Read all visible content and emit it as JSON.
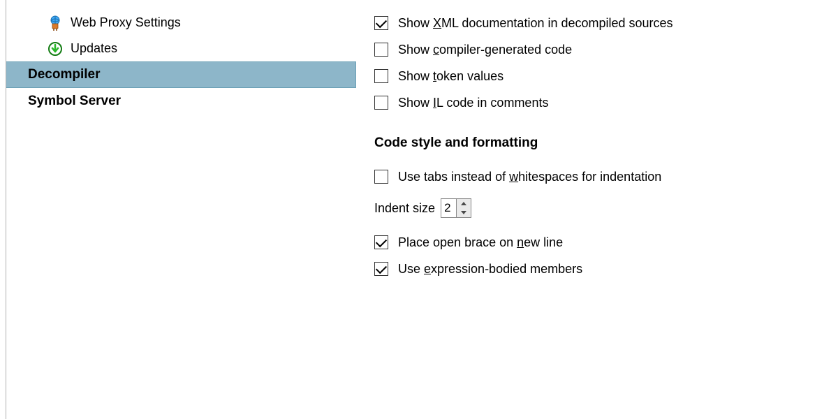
{
  "sidebar": {
    "items": [
      {
        "label": "Web Proxy Settings",
        "icon": "globe-plug-icon"
      },
      {
        "label": "Updates",
        "icon": "download-icon"
      }
    ],
    "roots": [
      {
        "label": "Decompiler",
        "selected": true
      },
      {
        "label": "Symbol Server",
        "selected": false
      }
    ]
  },
  "content": {
    "options_top": [
      {
        "id": "xml-doc",
        "checked": true,
        "text_before": "Show ",
        "mnemonic": "X",
        "text_after": "ML documentation in decompiled sources"
      },
      {
        "id": "compiler-gen",
        "checked": false,
        "text_before": "Show ",
        "mnemonic": "c",
        "text_after": "ompiler-generated code"
      },
      {
        "id": "token-values",
        "checked": false,
        "text_before": "Show ",
        "mnemonic": "t",
        "text_after": "oken values"
      },
      {
        "id": "il-code",
        "checked": false,
        "text_before": "Show ",
        "mnemonic": "I",
        "text_after": "L code in comments"
      }
    ],
    "section_title": "Code style and formatting",
    "use_tabs": {
      "checked": false,
      "text_before": "Use tabs instead of ",
      "mnemonic": "w",
      "text_after": "hitespaces for indentation"
    },
    "indent_label": "Indent size",
    "indent_value": "2",
    "options_bottom": [
      {
        "id": "open-brace",
        "checked": true,
        "text_before": "Place open brace on ",
        "mnemonic": "n",
        "text_after": "ew line"
      },
      {
        "id": "expr-bodied",
        "checked": true,
        "text_before": "Use ",
        "mnemonic": "e",
        "text_after": "xpression-bodied members"
      }
    ]
  }
}
